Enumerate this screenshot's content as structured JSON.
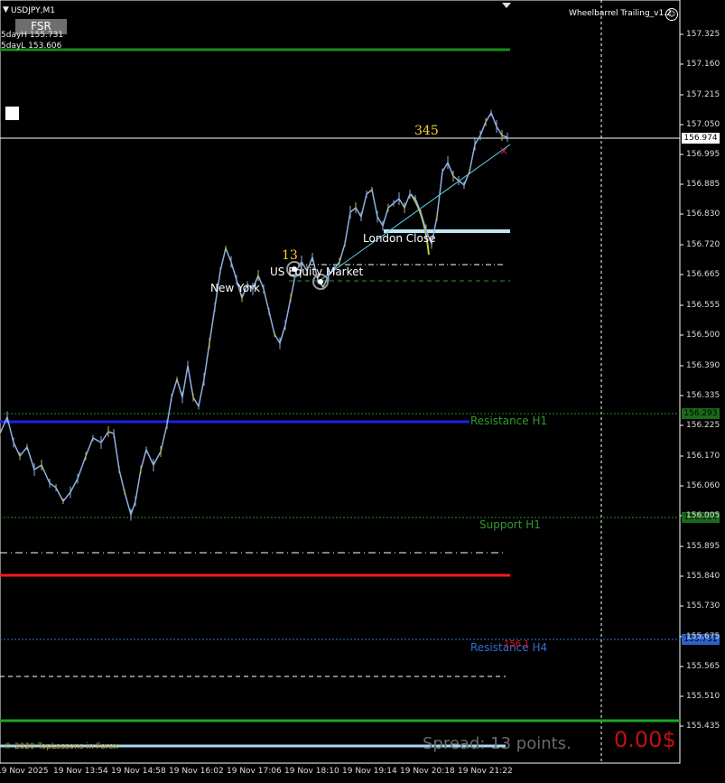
{
  "symbol_title": "USDJPY,M1",
  "fsr_button": "FSR",
  "five_day_high": "5dayH 155.731",
  "five_day_low": "5dayL 153.606",
  "ea_name": "Wheelbarrel Trailing_v1.2",
  "current_price": "156.974",
  "count_345": "345",
  "count_13": "13",
  "labels": {
    "london_close": "London Close",
    "new_york": "New York",
    "us_equity": "US Equity Market",
    "resistance_h1": "Resistance H1",
    "support_h1": "Support H1",
    "resistance_h4": "Resistance H4",
    "resistance_h4_price": "156.1"
  },
  "price_tags": {
    "resistance_h1": "156.293",
    "support_h1": "156.034",
    "resistance_h4": "155.731"
  },
  "spread_text": "Spread: 13 points.",
  "profit_text": "0.00$",
  "copyright": "© 2020 TopLessons in Forex",
  "price_axis": [
    "157.325",
    "157.160",
    "156.995",
    "156.830",
    "156.665",
    "156.500",
    "156.335",
    "156.170",
    "156.005",
    "155.840",
    "155.675",
    "155.510",
    "157.215",
    "157.050",
    "156.885",
    "156.720",
    "156.555",
    "156.390",
    "156.225",
    "156.060",
    "155.895",
    "155.730",
    "155.565",
    "155.435"
  ],
  "price_axis_ordered": [
    "157.325",
    "157.160",
    "157.215",
    "157.050",
    "156.995",
    "156.885",
    "156.830",
    "156.720",
    "156.665",
    "156.555",
    "156.500",
    "156.390",
    "156.335",
    "156.225",
    "156.170",
    "156.060",
    "156.005",
    "155.895",
    "155.840",
    "155.730",
    "155.675",
    "155.565",
    "155.510",
    "155.435"
  ],
  "time_axis": [
    "19 Nov 2025",
    "19 Nov 13:54",
    "19 Nov 14:58",
    "19 Nov 16:02",
    "19 Nov 17:06",
    "19 Nov 18:10",
    "19 Nov 19:14",
    "19 Nov 20:18",
    "19 Nov 21:22"
  ],
  "colors": {
    "background": "#000000",
    "resistance_h1_line": "#1f1fe6",
    "red_line": "#ff1a1a",
    "green_line": "#1ea51e",
    "lightblue_line": "#a8d8ee",
    "candles": "#8fb1e0"
  }
}
